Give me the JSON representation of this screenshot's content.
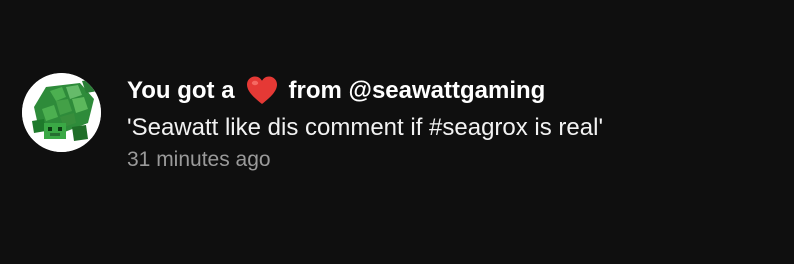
{
  "notification": {
    "avatar_icon": "sea-turtle-avatar-icon",
    "prefix": "You got a",
    "reaction_icon": "heart-icon",
    "reaction_color": "#e53935",
    "suffix": "from @seawattgaming",
    "comment": "'Seawatt like dis comment if #seagrox is real'",
    "timestamp": "31 minutes ago"
  },
  "colors": {
    "background": "#0f0f0f",
    "primary_text": "#ffffff",
    "secondary_text": "#9a9a9a",
    "avatar_bg": "#ffffff"
  }
}
